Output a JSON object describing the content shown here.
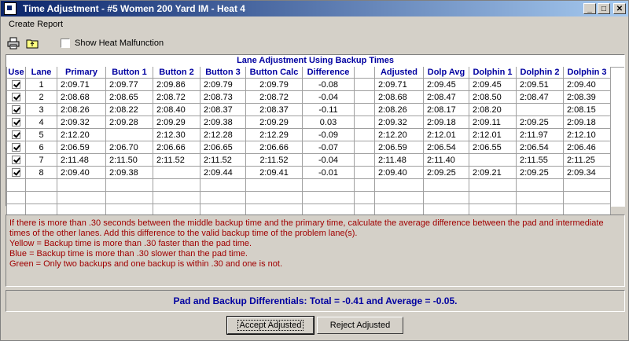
{
  "window": {
    "title": "Time Adjustment - #5 Women 200 Yard IM - Heat 4",
    "min_label": "_",
    "max_label": "□",
    "close_label": "✕"
  },
  "menu": {
    "create_report": "Create Report"
  },
  "toolbar": {
    "show_malfunction_label": "Show Heat Malfunction",
    "show_malfunction_checked": false
  },
  "grid": {
    "title": "Lane Adjustment Using Backup Times",
    "columns": [
      "Use",
      "Lane",
      "Primary",
      "Button 1",
      "Button 2",
      "Button 3",
      "Button Calc",
      "Difference",
      "",
      "Adjusted",
      "Dolp Avg",
      "Dolphin 1",
      "Dolphin 2",
      "Dolphin 3"
    ],
    "rows": [
      {
        "use": true,
        "cells": [
          "1",
          "2:09.71",
          "2:09.77",
          "2:09.86",
          "2:09.79",
          "2:09.79",
          "-0.08",
          "",
          "2:09.71",
          "2:09.45",
          "2:09.45",
          "2:09.51",
          "2:09.40"
        ]
      },
      {
        "use": true,
        "cells": [
          "2",
          "2:08.68",
          "2:08.65",
          "2:08.72",
          "2:08.73",
          "2:08.72",
          "-0.04",
          "",
          "2:08.68",
          "2:08.47",
          "2:08.50",
          "2:08.47",
          "2:08.39"
        ]
      },
      {
        "use": true,
        "cells": [
          "3",
          "2:08.26",
          "2:08.22",
          "2:08.40",
          "2:08.37",
          "2:08.37",
          "-0.11",
          "",
          "2:08.26",
          "2:08.17",
          "2:08.20",
          "",
          "2:08.15"
        ]
      },
      {
        "use": true,
        "cells": [
          "4",
          "2:09.32",
          "2:09.28",
          "2:09.29",
          "2:09.38",
          "2:09.29",
          "0.03",
          "",
          "2:09.32",
          "2:09.18",
          "2:09.11",
          "2:09.25",
          "2:09.18"
        ]
      },
      {
        "use": true,
        "cells": [
          "5",
          "2:12.20",
          "",
          "2:12.30",
          "2:12.28",
          "2:12.29",
          "-0.09",
          "",
          "2:12.20",
          "2:12.01",
          "2:12.01",
          "2:11.97",
          "2:12.10"
        ]
      },
      {
        "use": true,
        "cells": [
          "6",
          "2:06.59",
          "2:06.70",
          "2:06.66",
          "2:06.65",
          "2:06.66",
          "-0.07",
          "",
          "2:06.59",
          "2:06.54",
          "2:06.55",
          "2:06.54",
          "2:06.46"
        ]
      },
      {
        "use": true,
        "cells": [
          "7",
          "2:11.48",
          "2:11.50",
          "2:11.52",
          "2:11.52",
          "2:11.52",
          "-0.04",
          "",
          "2:11.48",
          "2:11.40",
          "",
          "2:11.55",
          "2:11.25"
        ]
      },
      {
        "use": true,
        "cells": [
          "8",
          "2:09.40",
          "2:09.38",
          "",
          "2:09.44",
          "2:09.41",
          "-0.01",
          "",
          "2:09.40",
          "2:09.25",
          "2:09.21",
          "2:09.25",
          "2:09.34"
        ]
      }
    ],
    "empty_rows": 4
  },
  "info": {
    "lines": [
      "If there is more than .30 seconds between the middle backup time and the primary time, calculate the average difference between the pad and intermediate times of the other lanes.  Add this difference to the valid backup time of the problem lane(s).",
      "Yellow = Backup time is more than .30 faster than the pad time.",
      "Blue = Backup time is more than .30 slower than the pad time.",
      "Green = Only two backups and one backup is within .30 and one is not."
    ]
  },
  "differentials": "Pad and Backup Differentials: Total = -0.41 and Average = -0.05.",
  "buttons": {
    "accept": "Accept Adjusted",
    "reject": "Reject  Adjusted"
  }
}
